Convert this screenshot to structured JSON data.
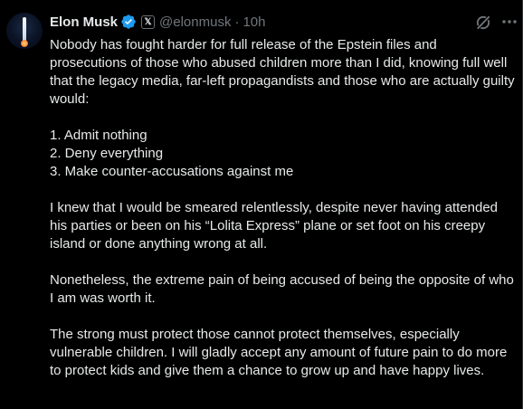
{
  "author": {
    "name": "Elon Musk",
    "handle": "@elonmusk",
    "separator": "·",
    "time": "10h",
    "badge_glyph": "𝕏",
    "verified_color": "#1d9bf0"
  },
  "icons": {
    "grok": "grok-icon",
    "more": "more-icon",
    "verified": "verified-badge-icon"
  },
  "post": {
    "para1": "Nobody has fought harder for full release of the Epstein files and prosecutions of those who abused children more than I did, knowing full well that the legacy media, far-left propagandists and those who are actually guilty would:",
    "list": [
      "1. Admit nothing",
      "2. Deny everything",
      "3. Make counter-accusations against me"
    ],
    "para2": "I knew that I would be smeared relentlessly, despite never having attended his parties or been on his “Lolita Express” plane or set foot on his creepy island or done anything wrong at all.",
    "para3": "Nonetheless, the extreme pain of being accused of being the opposite of who I am was worth it.",
    "para4": "The strong must protect those cannot protect themselves, especially vulnerable children. I will gladly accept any amount of future pain to do more to protect kids and give them a chance to grow up and have happy lives."
  }
}
